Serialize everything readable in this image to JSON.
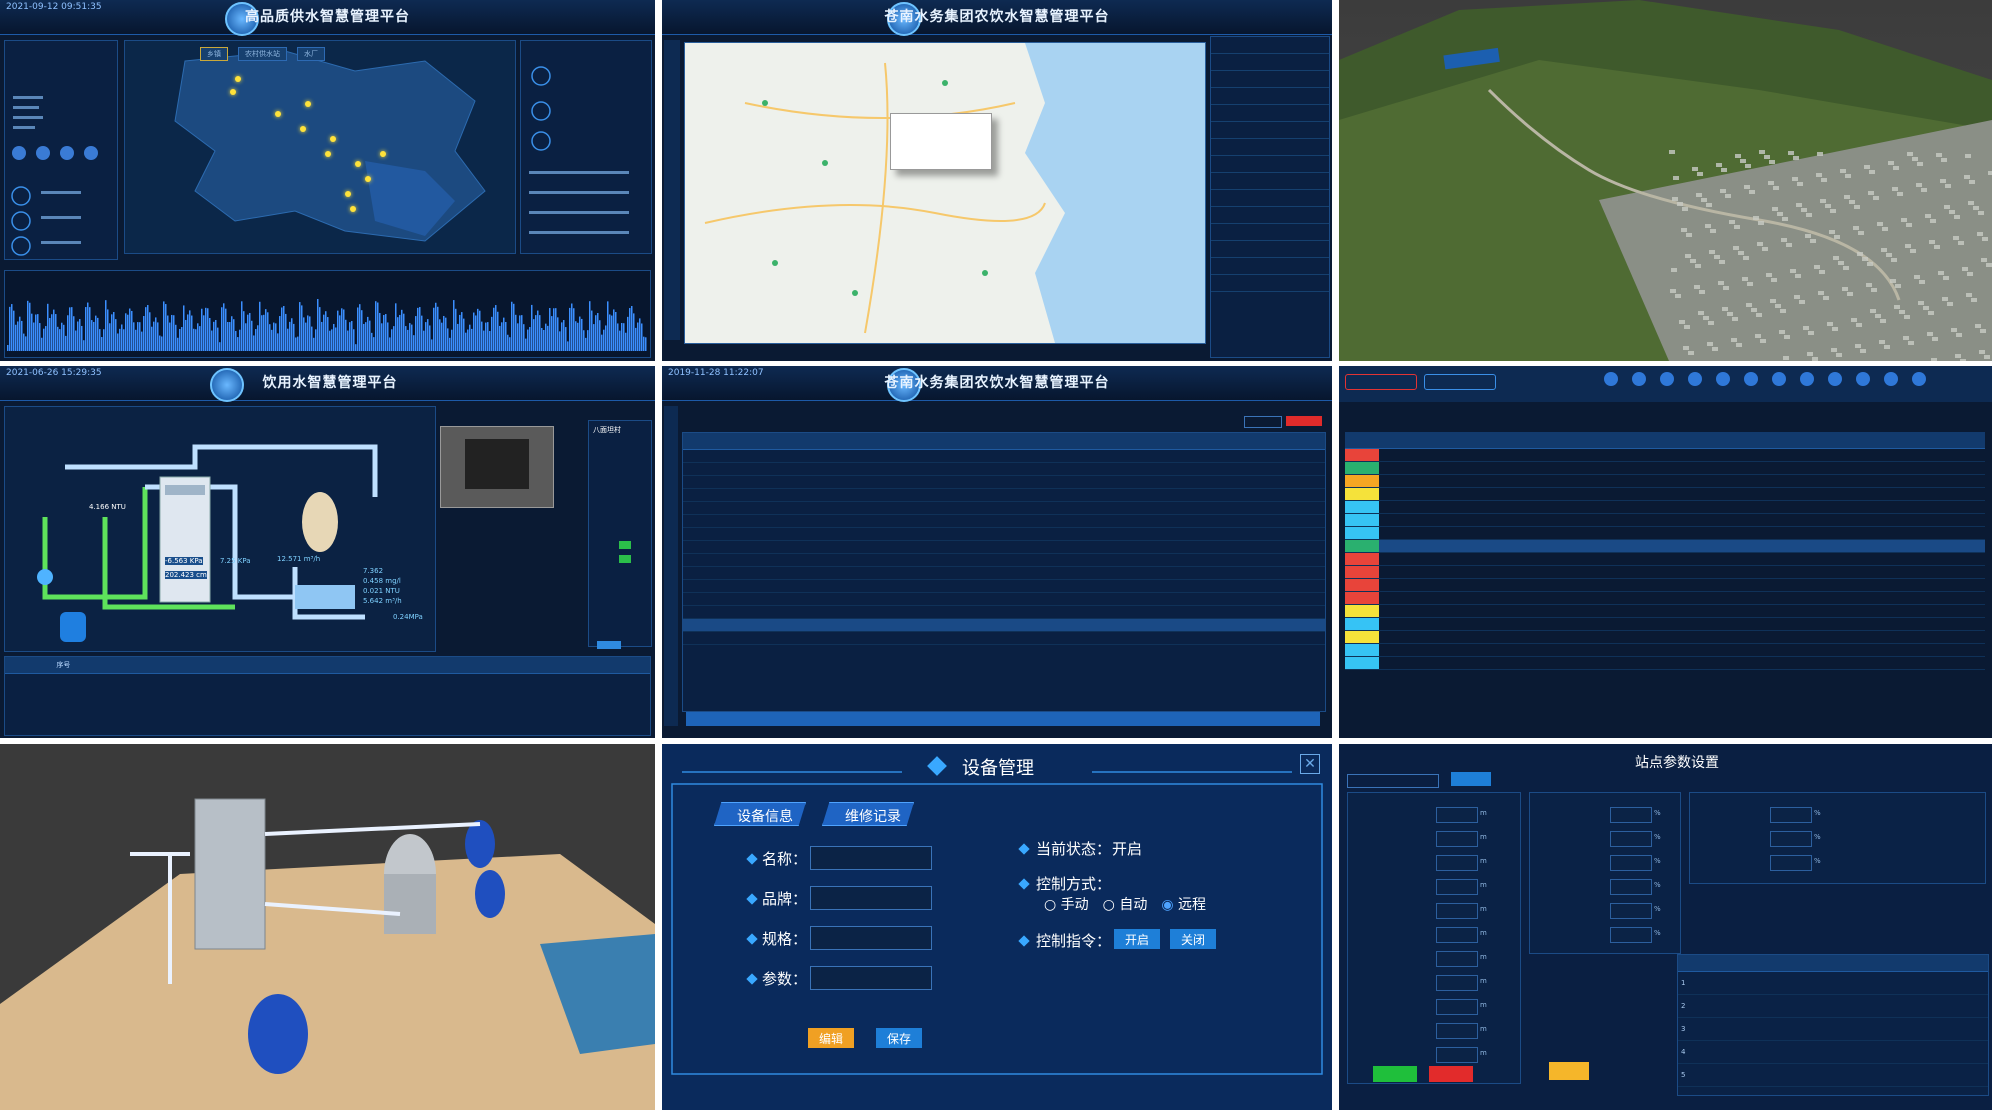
{
  "t1": {
    "title": "高品质供水智慧管理平台",
    "clock": "2021-09-12 09:51:35",
    "user": "",
    "tags": [
      "乡镇",
      "农村供水站",
      "水厂"
    ]
  },
  "t2": {
    "title": "苍南水务集团农饮水智慧管理平台",
    "clock": "",
    "user": "",
    "popup": "",
    "rows": [
      "",
      "",
      "",
      "",
      "",
      "",
      "",
      "",
      "",
      "",
      "",
      "",
      "",
      "",
      ""
    ]
  },
  "t4": {
    "title": "饮用水智慧管理平台",
    "clock": "2021-06-26 15:29:35",
    "user": "",
    "right_header": "八面坦村",
    "readings": {
      "ntu1": "4.166 NTU",
      "kpa1": "-6.563 KPa",
      "cm1": "202.423 cm",
      "kpa2": "7.25 KPa",
      "flow1": "12.571 m³/h",
      "v1": "7.362",
      "v2": "0.458 mg/l",
      "v3": "0.021 NTU",
      "v4": "5.642 m³/h",
      "v5": "0.24MPa"
    },
    "table_headers": [
      "",
      "序号",
      "",
      "",
      "",
      "",
      "",
      "",
      "",
      "",
      ""
    ]
  },
  "t5": {
    "title": "苍南水务集团农饮水智慧管理平台",
    "clock": "2019-11-28 11:22:07",
    "user": "",
    "rows": 15
  },
  "t6": {
    "rows": 17,
    "row_colors": [
      "#e8443a",
      "#2ab06f",
      "#f5a623",
      "#f5e23a",
      "#36c3f5",
      "#36c3f5",
      "#36c3f5",
      "#2ab06f",
      "#e8443a",
      "#e8443a",
      "#e8443a",
      "#e8443a",
      "#f5e23a",
      "#36c3f5",
      "#f5e23a",
      "#36c3f5",
      "#36c3f5"
    ]
  },
  "t8": {
    "title": "设备管理",
    "tabs": [
      "设备信息",
      "维修记录"
    ],
    "fields": [
      {
        "label": "名称：",
        "value": ""
      },
      {
        "label": "品牌：",
        "value": ""
      },
      {
        "label": "规格：",
        "value": ""
      },
      {
        "label": "参数：",
        "value": ""
      }
    ],
    "status_label": "当前状态：",
    "status_value": "开启",
    "mode_label": "控制方式：",
    "modes": [
      "手动",
      "自动",
      "远程"
    ],
    "mode_selected": 2,
    "cmd_label": "控制指令：",
    "cmd_open": "开启",
    "cmd_close": "关闭",
    "edit_button": "编辑",
    "save_button": "保存",
    "colors": {
      "edit": "#f0a023",
      "save": "#1e7fd8",
      "open": "#1e7fd8",
      "close": "#1e7fd8"
    }
  },
  "t9": {
    "title": "站点参数设置",
    "unit_m": "m",
    "unit_pct": "%",
    "row_numbers": [
      "1",
      "2",
      "3",
      "4",
      "5"
    ],
    "colors": {
      "green": "#1fbf3b",
      "red": "#e22b2b",
      "yellow": "#f5b62a"
    }
  }
}
